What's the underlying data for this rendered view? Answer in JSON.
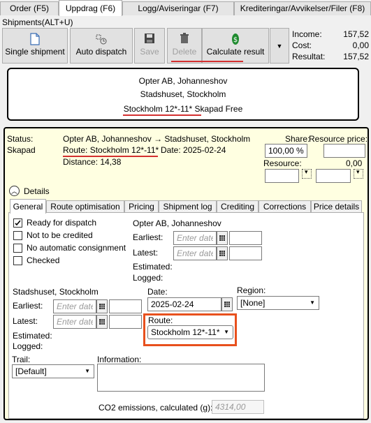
{
  "top_tabs": [
    {
      "label": "Order (F5)"
    },
    {
      "label": "Uppdrag (F6)"
    },
    {
      "label": "Logg/Aviseringar (F7)"
    },
    {
      "label": "Krediteringar/Avvikelser/Filer (F8)"
    }
  ],
  "section_label": "Shipments(ALT+U)",
  "toolbar": {
    "single_shipment": "Single shipment",
    "auto_dispatch": "Auto dispatch",
    "save": "Save",
    "delete": "Delete",
    "calculate_result": "Calculate result"
  },
  "totals": {
    "income_label": "Income:",
    "income_value": "157,52",
    "cost_label": "Cost:",
    "cost_value": "0,00",
    "result_label": "Resultat:",
    "result_value": "157,52"
  },
  "summary": {
    "line1": "Opter AB, Johanneshov",
    "line2": "Stadshuset, Stockholm",
    "line3": "Stockholm 12*-11* Skapad Free"
  },
  "status": {
    "label": "Status:",
    "value": "Skapad",
    "route_line": "Opter AB, Johanneshov → Stadshuset, Stockholm",
    "route_prefix": "Route: Stockholm 12*-11*",
    "date_text": "Date: 2025-02-24",
    "distance": "Distance: 14,38",
    "share_label": "Share:",
    "share_value": "100,00 %",
    "resource_price_label": "Resource price:",
    "resource_label": "Resource:",
    "resource_value": "0,00"
  },
  "details_toggle": "Details",
  "inner_tabs": [
    {
      "label": "General"
    },
    {
      "label": "Route optimisation"
    },
    {
      "label": "Pricing"
    },
    {
      "label": "Shipment log"
    },
    {
      "label": "Crediting"
    },
    {
      "label": "Corrections"
    },
    {
      "label": "Price details"
    }
  ],
  "checkboxes": [
    {
      "label": "Ready for dispatch",
      "checked": true
    },
    {
      "label": "Not to be credited",
      "checked": false
    },
    {
      "label": "No automatic consignment",
      "checked": false
    },
    {
      "label": "Checked",
      "checked": false
    }
  ],
  "pickup": {
    "title": "Opter AB, Johanneshov",
    "earliest": "Earliest:",
    "latest": "Latest:",
    "estimated": "Estimated:",
    "logged": "Logged:",
    "placeholder": "Enter date"
  },
  "delivery": {
    "title": "Stadshuset, Stockholm",
    "earliest": "Earliest:",
    "latest": "Latest:",
    "estimated": "Estimated:",
    "logged": "Logged:",
    "placeholder": "Enter date"
  },
  "date_field": {
    "label": "Date:",
    "value": "2025-02-24"
  },
  "region": {
    "label": "Region:",
    "value": "[None]"
  },
  "route_field": {
    "label": "Route:",
    "value": "Stockholm 12*-11*"
  },
  "trail": {
    "label": "Trail:",
    "value": "[Default]"
  },
  "information": {
    "label": "Information:"
  },
  "co2": {
    "label": "CO2 emissions, calculated (g):",
    "value": "4314,00"
  }
}
